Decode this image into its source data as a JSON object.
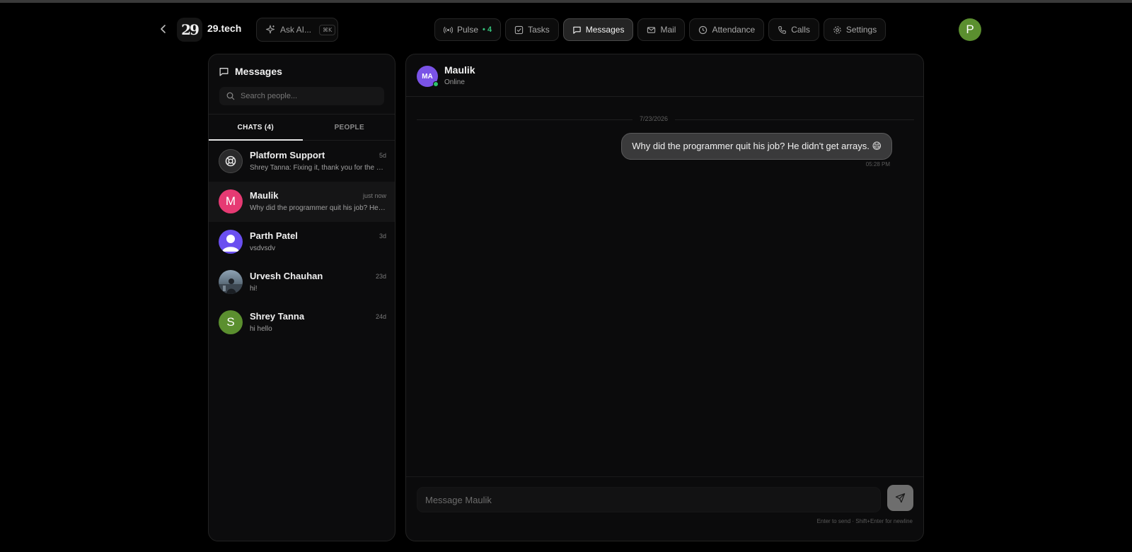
{
  "brand": {
    "name": "29.tech",
    "logo_text": "29"
  },
  "ask_ai": {
    "label": "Ask AI...",
    "shortcut": "⌘K"
  },
  "nav": {
    "items": [
      {
        "label": "Pulse",
        "badge": "• 4",
        "icon": "broadcast-icon"
      },
      {
        "label": "Tasks",
        "icon": "checkbox-icon"
      },
      {
        "label": "Messages",
        "icon": "message-icon",
        "active": true
      },
      {
        "label": "Mail",
        "icon": "mail-icon"
      },
      {
        "label": "Attendance",
        "icon": "clock-icon"
      },
      {
        "label": "Calls",
        "icon": "phone-icon"
      },
      {
        "label": "Settings",
        "icon": "gear-icon"
      }
    ]
  },
  "user": {
    "initial": "P",
    "color": "#5b8f2f"
  },
  "messages_panel": {
    "title": "Messages",
    "search_placeholder": "Search people...",
    "tabs": [
      {
        "label": "CHATS (4)",
        "active": true
      },
      {
        "label": "PEOPLE"
      }
    ],
    "chats": [
      {
        "name": "Platform Support",
        "time": "5d",
        "preview": "Shrey Tanna: Fixing it, thank you for the report",
        "avatar": "support-icon"
      },
      {
        "name": "Maulik",
        "time": "just now",
        "preview": "Why did the programmer quit his job? He didn't get arrays. 😄",
        "avatar_initial": "M",
        "avatar_color": "#e63a73",
        "selected": true
      },
      {
        "name": "Parth Patel",
        "time": "3d",
        "preview": "vsdvsdv",
        "avatar": "default-user-icon",
        "avatar_color": "#6a4ff0"
      },
      {
        "name": "Urvesh Chauhan",
        "time": "23d",
        "preview": "hi!",
        "avatar": "photo-avatar"
      },
      {
        "name": "Shrey Tanna",
        "time": "24d",
        "preview": "hi hello",
        "avatar_initial": "S",
        "avatar_color": "#5b8f2f"
      }
    ]
  },
  "conversation": {
    "contact": {
      "name": "Maulik",
      "initials": "MA",
      "status": "Online",
      "avatar_color": "#7a53e6"
    },
    "date": "7/23/2026",
    "messages": [
      {
        "text": "Why did the programmer quit his job? He didn't get arrays. 😄",
        "time": "05:28 PM",
        "outgoing": true
      }
    ],
    "input_placeholder": "Message Maulik",
    "hint": "Enter to send · Shift+Enter for newline"
  }
}
